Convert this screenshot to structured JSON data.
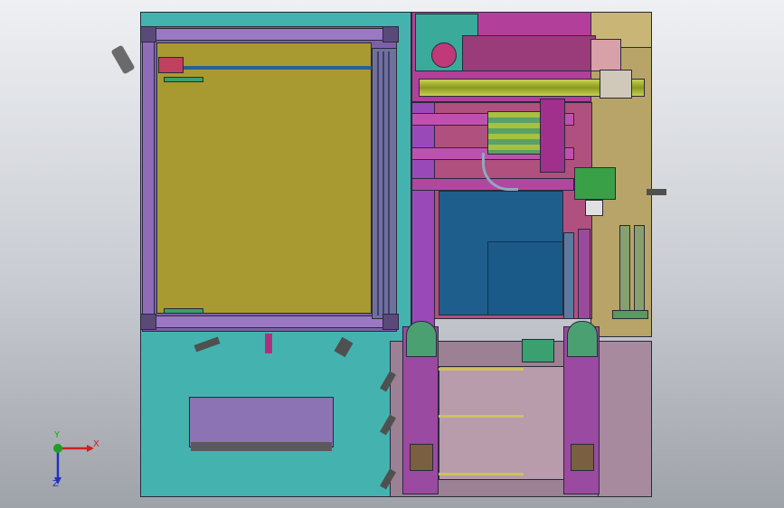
{
  "viewport": {
    "background_top": "#eef0f3",
    "background_bottom": "#9ea2a9"
  },
  "triad": {
    "x_label": "X",
    "y_label": "Y",
    "z_label": "Z",
    "x_color": "#d02020",
    "y_color": "#20a020",
    "z_color": "#2030c0"
  },
  "model": {
    "frame_color": "#44b3b0",
    "door_color": "#7e60a8",
    "panel_color": "#a89a30",
    "blue_panel_color": "#1d5e8c",
    "pink_color": "#b0507e",
    "mauve_color": "#9c8094",
    "right_panel_color": "#a89a6a"
  }
}
